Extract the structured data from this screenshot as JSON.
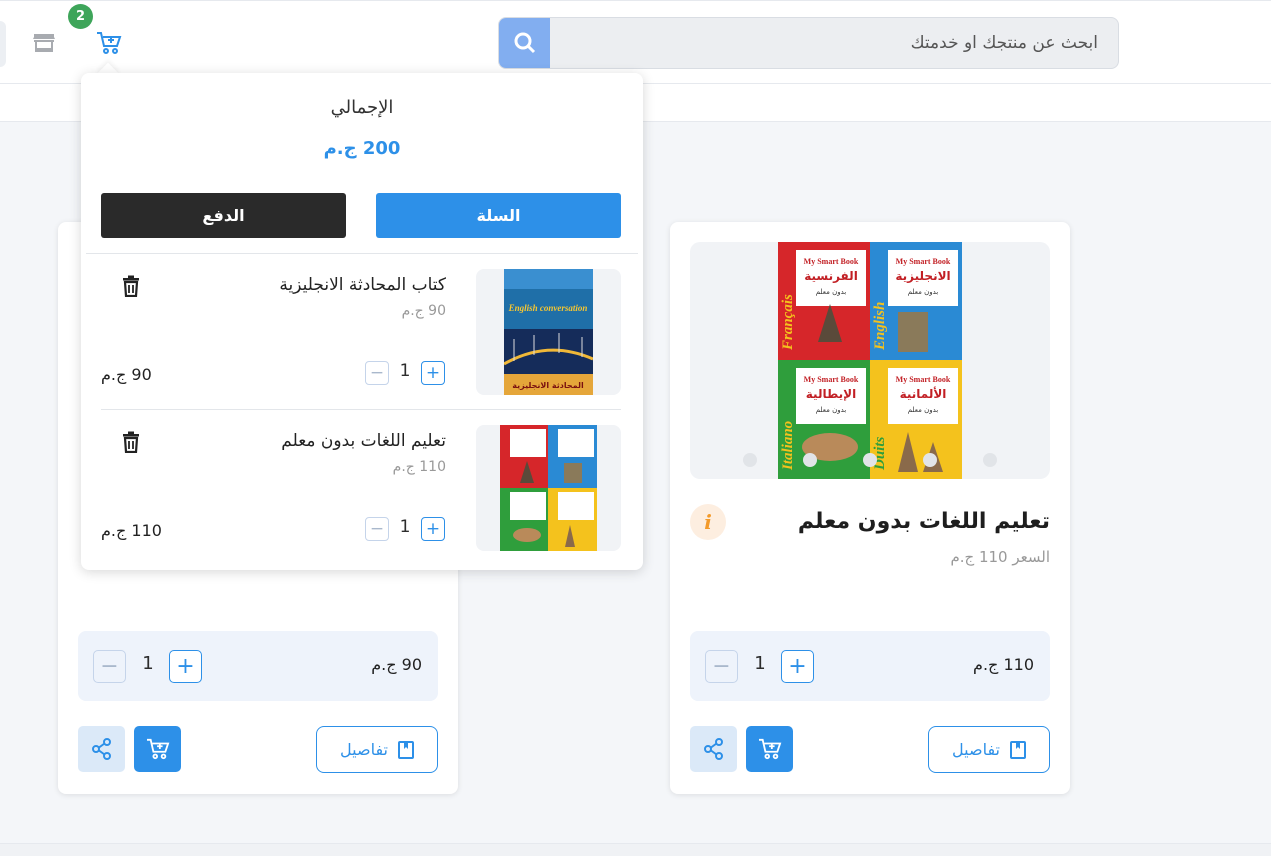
{
  "header": {
    "search_placeholder": "ابحث عن منتجك او خدمتك",
    "cart_count": "2"
  },
  "cart_dropdown": {
    "total_label": "الإجمالي",
    "total_value": "200 ج.م",
    "cart_button": "السلة",
    "checkout_button": "الدفع",
    "items": [
      {
        "name": "كتاب المحادثة الانجليزية",
        "unit_price": "90 ج.م",
        "qty": "1",
        "total": "90 ج.م",
        "cover_title": "English conversation",
        "cover_subtitle": "المحادثة الانجليزية"
      },
      {
        "name": "تعليم اللغات بدون معلم",
        "unit_price": "110 ج.م",
        "qty": "1",
        "total": "110 ج.م"
      }
    ]
  },
  "products": [
    {
      "title": "تعليم اللغات بدون معلم",
      "price_text": "السعر 110 ج.م",
      "qty": "1",
      "qty_price": "110 ج.م",
      "details_label": "تفاصيل",
      "info_glyph": "i",
      "cover": {
        "series": "My Smart Book",
        "quadrants": [
          {
            "lang": "Français",
            "title": "الفرنسية",
            "sub": "بدون معلم",
            "color": "#d6262a"
          },
          {
            "lang": "English",
            "title": "الانجليزية",
            "sub": "بدون معلم",
            "color": "#2a8ad4"
          },
          {
            "lang": "Italiano",
            "title": "الإيطالية",
            "sub": "بدون معلم",
            "color": "#2f9e3c"
          },
          {
            "lang": "Duits",
            "title": "الألمانية",
            "sub": "بدون معلم",
            "color": "#f4c21d"
          }
        ]
      }
    },
    {
      "qty": "1",
      "qty_price": "90 ج.م",
      "details_label": "تفاصيل"
    }
  ]
}
